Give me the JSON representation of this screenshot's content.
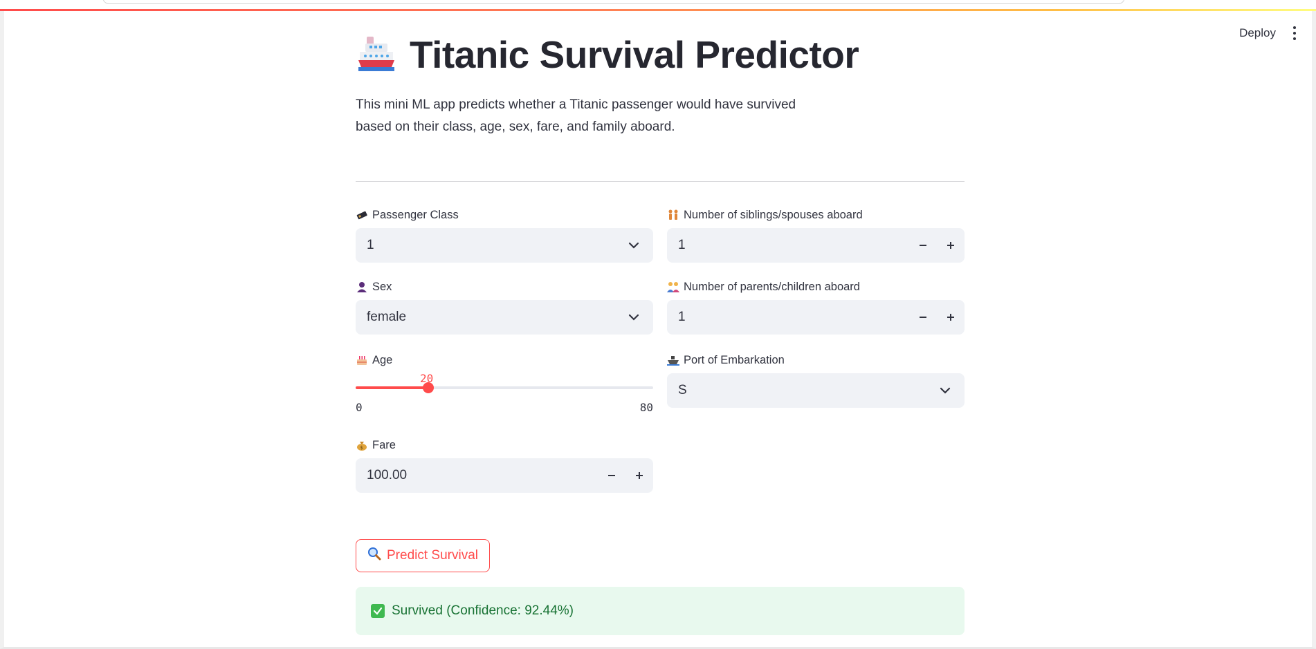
{
  "header": {
    "deploy_label": "Deploy"
  },
  "main": {
    "title": "Titanic Survival Predictor",
    "title_icon": "ship-icon",
    "description_line1": "This mini ML app predicts whether a Titanic passenger would have survived",
    "description_line2": "based on their class, age, sex, fare, and family aboard."
  },
  "fields": {
    "pclass": {
      "label": "Passenger Class",
      "icon": "ticket-icon",
      "value": "1"
    },
    "sex": {
      "label": "Sex",
      "icon": "person-icon",
      "value": "female"
    },
    "age": {
      "label": "Age",
      "icon": "cake-icon",
      "value": "20",
      "min": "0",
      "max": "80",
      "fraction": 0.25
    },
    "fare": {
      "label": "Fare",
      "icon": "money-bag-icon",
      "value": "100.00"
    },
    "sibsp": {
      "label": "Number of siblings/spouses aboard",
      "icon": "people-icon",
      "value": "1"
    },
    "parch": {
      "label": "Number of parents/children aboard",
      "icon": "family-icon",
      "value": "1"
    },
    "embarked": {
      "label": "Port of Embarkation",
      "icon": "ship-port-icon",
      "value": "S"
    }
  },
  "actions": {
    "predict_label": "Predict Survival",
    "predict_icon": "magnifier-icon"
  },
  "result": {
    "text": "Survived (Confidence: 92.44%)",
    "icon": "check-box-icon",
    "color": "#177233",
    "background": "#e8f9ee"
  },
  "colors": {
    "accent": "#ff4b4b",
    "input_bg": "#f0f2f6",
    "text": "#31333f"
  }
}
